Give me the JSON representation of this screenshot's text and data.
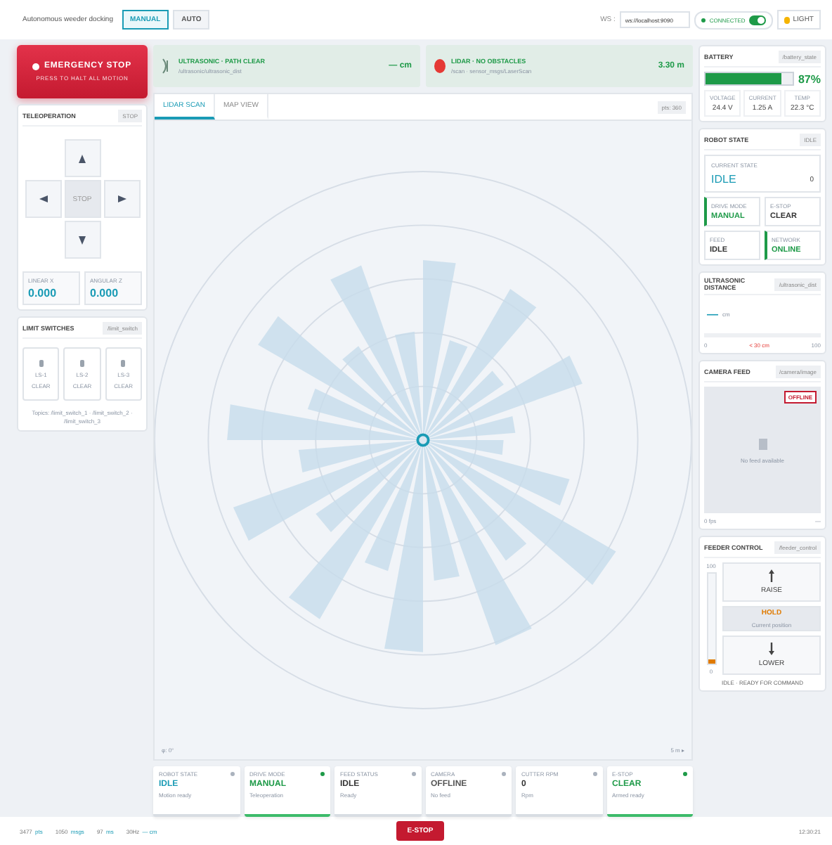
{
  "header": {
    "title": "Autonomous weeder docking",
    "modes": [
      {
        "label": "MANUAL",
        "selected": true
      },
      {
        "label": "AUTO",
        "selected": false
      }
    ],
    "ws_label": "WS :",
    "ws_url": "ws://localhost:9090",
    "connection": {
      "label": "CONNECTED",
      "on": true
    },
    "theme_button": "LIGHT"
  },
  "estop": {
    "title": "EMERGENCY STOP",
    "subtitle": "PRESS TO HALT ALL MOTION"
  },
  "teleop": {
    "title": "TELEOPERATION",
    "badge": "STOP",
    "center": "STOP",
    "readouts": [
      {
        "label": "LINEAR X",
        "value": "0.000"
      },
      {
        "label": "ANGULAR Z",
        "value": "0.000"
      }
    ]
  },
  "limit_switches": {
    "title": "LIMIT SWITCHES",
    "badge": "/limit_switch",
    "switches": [
      {
        "name": "LS-1",
        "state": "CLEAR"
      },
      {
        "name": "LS-2",
        "state": "CLEAR"
      },
      {
        "name": "LS-3",
        "state": "CLEAR"
      }
    ],
    "topics": "Topics: /limit_switch_1 · /limit_switch_2 · /limit_switch_3"
  },
  "banners": [
    {
      "kind": "ultrasonic",
      "title": "ULTRASONIC · PATH CLEAR",
      "topic": "/ultrasonic/ultrasonic_dist",
      "value": "— cm"
    },
    {
      "kind": "lidar",
      "title": "LIDAR · NO OBSTACLES",
      "topic": "/scan · sensor_msgs/LaserScan",
      "value": "3.30 m"
    }
  ],
  "view": {
    "tabs": [
      {
        "label": "LIDAR SCAN",
        "selected": true
      },
      {
        "label": "MAP VIEW",
        "selected": false
      }
    ],
    "badge": "pts: 360",
    "corner_left": "φ: 0°",
    "corner_right": "5 m ▸"
  },
  "status_cards": [
    {
      "label": "ROBOT STATE",
      "value": "IDLE",
      "note": "Motion ready",
      "color": "#1a9bb5",
      "active": false
    },
    {
      "label": "DRIVE MODE",
      "value": "MANUAL",
      "note": "Teleoperation",
      "color": "#1e9a48",
      "active": true
    },
    {
      "label": "FEED STATUS",
      "value": "IDLE",
      "note": "Ready",
      "color": "#333333",
      "active": false
    },
    {
      "label": "CAMERA",
      "value": "OFFLINE",
      "note": "No feed",
      "color": "#555555",
      "active": false
    },
    {
      "label": "CUTTER RPM",
      "value": "0",
      "note": "Rpm",
      "color": "#333333",
      "active": false
    },
    {
      "label": "E-STOP",
      "value": "CLEAR",
      "note": "Armed ready",
      "color": "#1e9a48",
      "active": true
    }
  ],
  "battery": {
    "title": "BATTERY",
    "badge": "/battery_state",
    "level": 0.87,
    "percent": "87%",
    "stats": [
      {
        "label": "VOLTAGE",
        "value": "24.4 V"
      },
      {
        "label": "CURRENT",
        "value": "1.25 A"
      },
      {
        "label": "TEMP",
        "value": "22.3 °C"
      }
    ]
  },
  "robot_state": {
    "title": "ROBOT STATE",
    "badge": "IDLE",
    "current_label": "CURRENT STATE",
    "current_value": "IDLE",
    "current_code": "0",
    "items": [
      {
        "label": "DRIVE MODE",
        "value": "MANUAL",
        "highlight": true
      },
      {
        "label": "E-STOP",
        "value": "CLEAR",
        "highlight": false
      },
      {
        "label": "FEED",
        "value": "IDLE",
        "highlight": false
      },
      {
        "label": "NETWORK",
        "value": "ONLINE",
        "highlight": true
      }
    ]
  },
  "ultrasonic": {
    "title": "ULTRASONIC DISTANCE",
    "badge": "/ultrasonic_dist",
    "value": "—",
    "unit": "cm",
    "scale_min": "0",
    "threshold": "< 30 cm",
    "scale_max": "100"
  },
  "camera": {
    "title": "CAMERA FEED",
    "badge": "/camera/image",
    "tag": "OFFLINE",
    "message": "No feed available",
    "fps": "0 fps",
    "res": "—"
  },
  "feeder": {
    "title": "FEEDER CONTROL",
    "badge": "/feeder_control",
    "gauge_max": "100",
    "gauge_min": "0",
    "level": 0.05,
    "raise": "RAISE",
    "hold": "HOLD",
    "hold_note": "Current position",
    "lower": "LOWER",
    "status": "IDLE · READY FOR COMMAND"
  },
  "footer": {
    "stats": [
      {
        "value": "3477",
        "label": "pts"
      },
      {
        "value": "1050",
        "label": "msgs"
      },
      {
        "value": "97",
        "label": "ms"
      },
      {
        "value": "30Hz",
        "label": "— cm"
      }
    ],
    "estop": "E-STOP",
    "clock": "12:30:21"
  }
}
